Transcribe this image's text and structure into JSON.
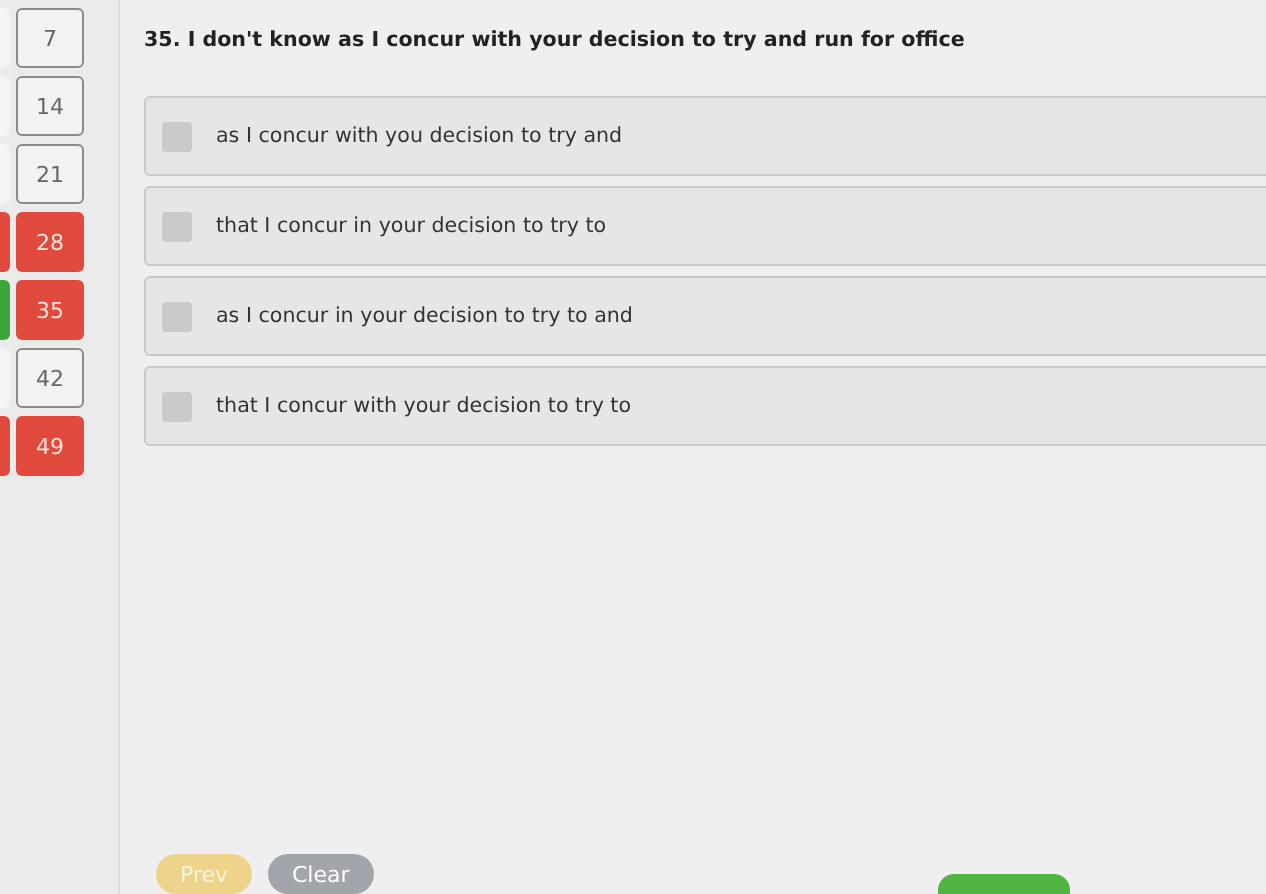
{
  "previous_column": [
    {
      "color": "#f4f4f4"
    },
    {
      "color": "#f4f4f4"
    },
    {
      "color": "#f4f4f4"
    },
    {
      "color": "#e04a3c"
    },
    {
      "color": "#3aa53a"
    },
    {
      "color": "#f4f4f4"
    },
    {
      "color": "#e04a3c"
    }
  ],
  "navigator": [
    {
      "label": "7",
      "wrong": false
    },
    {
      "label": "14",
      "wrong": false
    },
    {
      "label": "21",
      "wrong": false
    },
    {
      "label": "28",
      "wrong": true
    },
    {
      "label": "35",
      "wrong": true
    },
    {
      "label": "42",
      "wrong": false
    },
    {
      "label": "49",
      "wrong": true
    }
  ],
  "question": "35. I don't know as I concur with your decision to try and run for office",
  "options": [
    {
      "text": "as I concur with you decision to try and",
      "checked": false
    },
    {
      "text": "that I concur in your decision to try to",
      "checked": false
    },
    {
      "text": "as I concur in your decision to try to and",
      "checked": false
    },
    {
      "text": "that I concur with your decision to try to",
      "checked": false
    }
  ],
  "buttons": [
    {
      "kind": "prev",
      "label": "Prev"
    },
    {
      "kind": "clear",
      "label": "Clear"
    },
    {
      "kind": "submit"
    }
  ]
}
